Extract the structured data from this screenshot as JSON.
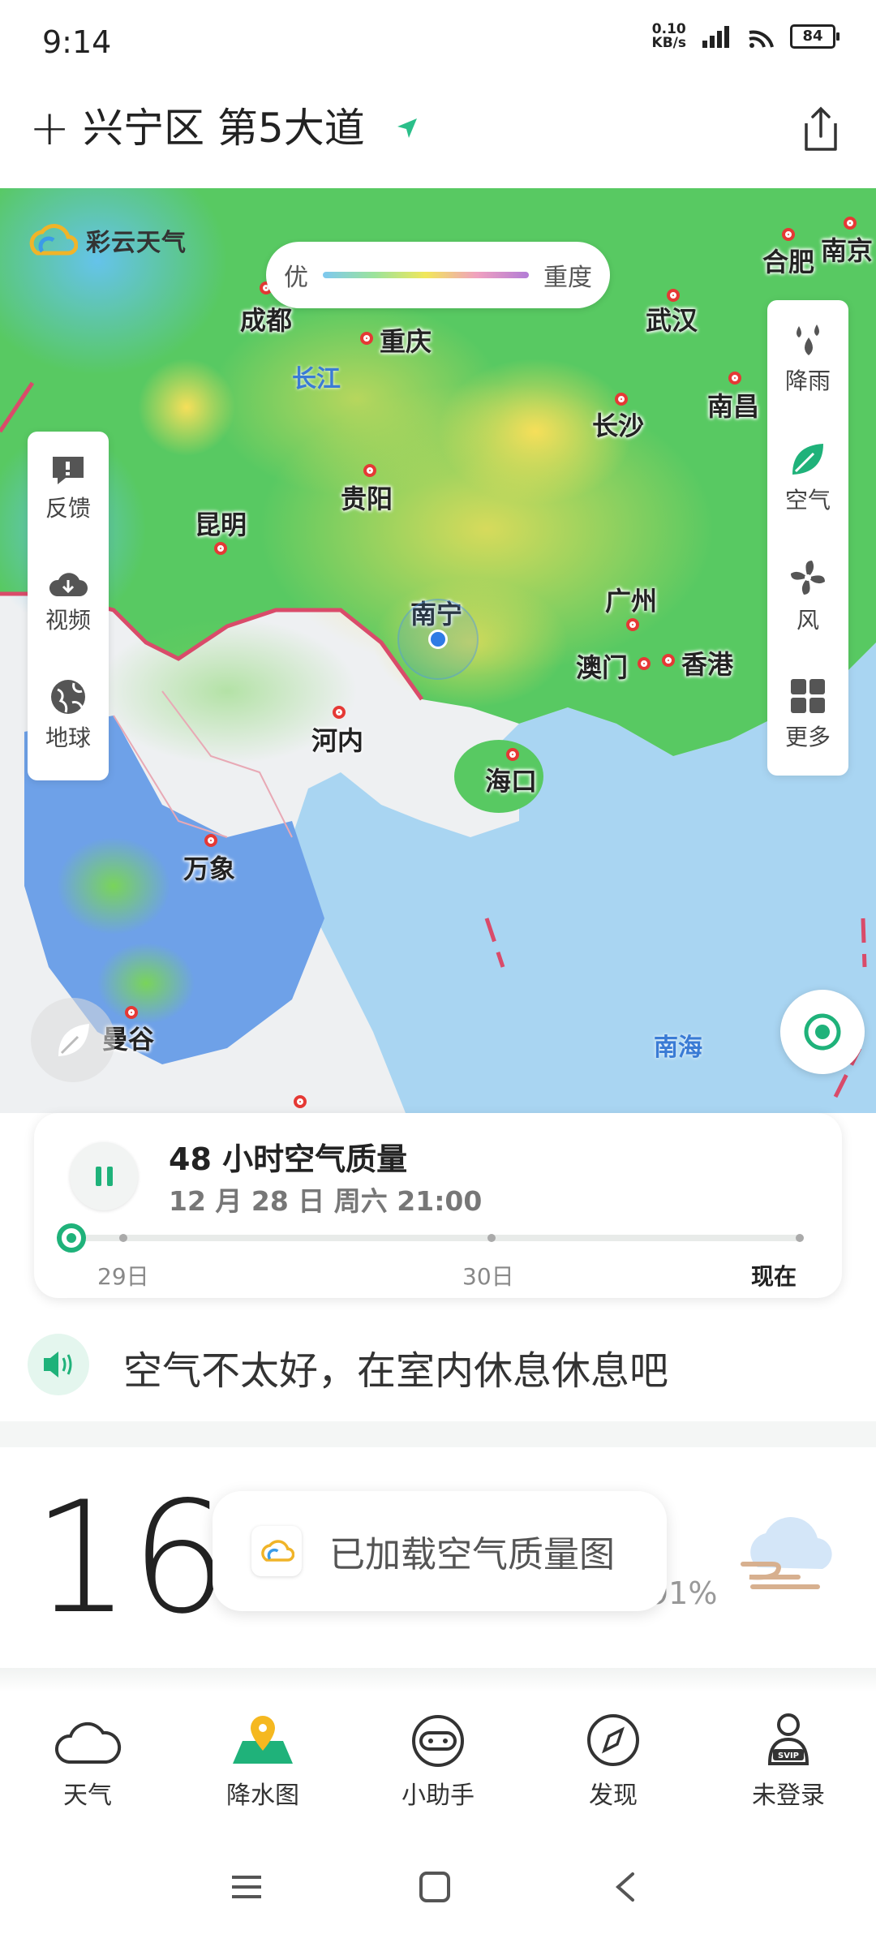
{
  "status": {
    "time": "9:14",
    "net_speed_value": "0.10",
    "net_speed_unit": "KB/s",
    "battery": "84"
  },
  "header": {
    "location": "兴宁区 第5大道"
  },
  "map": {
    "brand": "彩云天气",
    "legend": {
      "low": "优",
      "high": "重度"
    },
    "cities": [
      "成都",
      "重庆",
      "武汉",
      "合肥",
      "南京",
      "长沙",
      "南昌",
      "贵阳",
      "昆明",
      "南宁",
      "广州",
      "澳门",
      "香港",
      "河内",
      "海口",
      "万象",
      "曼谷"
    ],
    "water_labels": [
      "长江",
      "南海"
    ],
    "left_panel": [
      "反馈",
      "视频",
      "地球"
    ],
    "right_panel": [
      "降雨",
      "空气",
      "风",
      "更多"
    ]
  },
  "timeline": {
    "title": "48 小时空气质量",
    "date": "12 月 28 日 周六 21:00",
    "labels": {
      "start": "29日",
      "mid": "30日",
      "end": "现在"
    },
    "progress": 0
  },
  "tip": {
    "text": "空气不太好，在室内休息休息吧"
  },
  "weather": {
    "temperature": "16°",
    "humidity": "91%"
  },
  "toast": {
    "text": "已加载空气质量图"
  },
  "nav": [
    {
      "label": "天气",
      "icon": "cloud-icon"
    },
    {
      "label": "降水图",
      "icon": "map-pin-icon"
    },
    {
      "label": "小助手",
      "icon": "assistant-icon"
    },
    {
      "label": "发现",
      "icon": "compass-icon"
    },
    {
      "label": "未登录",
      "icon": "user-icon"
    }
  ],
  "colors": {
    "accent": "#1fb27a",
    "city_dot": "#e53935",
    "water_text": "#3a7bd5"
  }
}
